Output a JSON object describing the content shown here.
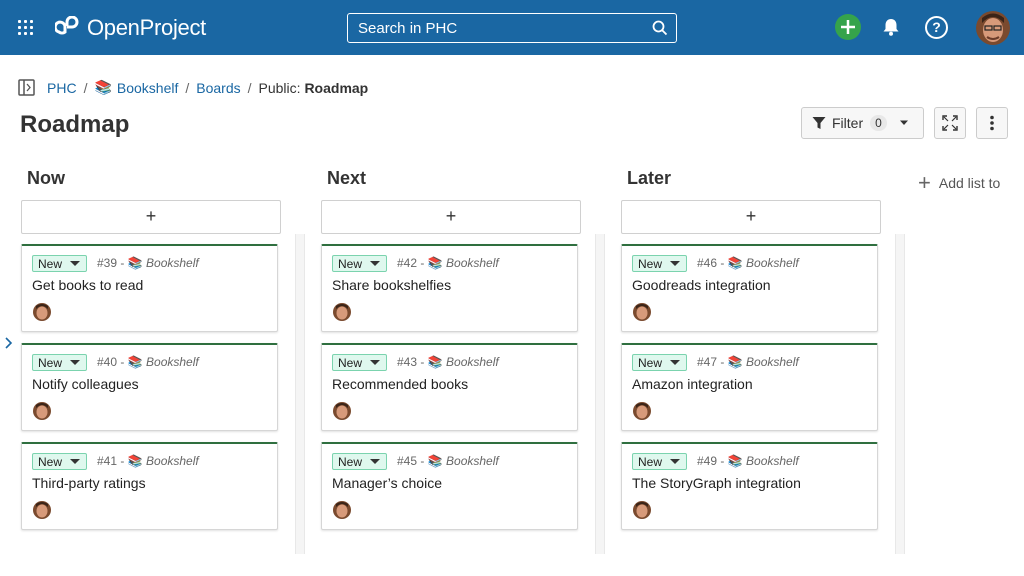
{
  "header": {
    "logo_text": "OpenProject",
    "search_placeholder": "Search in PHC",
    "accent": "#1a67a3",
    "add_color": "#35a34b"
  },
  "breadcrumb": {
    "items": [
      "PHC",
      "Bookshelf",
      "Boards"
    ],
    "current_prefix": "Public:",
    "current_name": "Roadmap"
  },
  "page": {
    "title": "Roadmap"
  },
  "toolbar": {
    "filter_label": "Filter",
    "filter_count": "0"
  },
  "add_card_label": "+",
  "add_list_label": "Add list to",
  "columns": [
    {
      "title": "Now",
      "cards": [
        {
          "status": "New",
          "id": "#39",
          "project": "Bookshelf",
          "title": "Get books to read"
        },
        {
          "status": "New",
          "id": "#40",
          "project": "Bookshelf",
          "title": "Notify colleagues"
        },
        {
          "status": "New",
          "id": "#41",
          "project": "Bookshelf",
          "title": "Third-party ratings"
        }
      ]
    },
    {
      "title": "Next",
      "cards": [
        {
          "status": "New",
          "id": "#42",
          "project": "Bookshelf",
          "title": "Share bookshelfies"
        },
        {
          "status": "New",
          "id": "#43",
          "project": "Bookshelf",
          "title": "Recommended books"
        },
        {
          "status": "New",
          "id": "#45",
          "project": "Bookshelf",
          "title": "Manager’s choice"
        }
      ]
    },
    {
      "title": "Later",
      "cards": [
        {
          "status": "New",
          "id": "#46",
          "project": "Bookshelf",
          "title": "Goodreads integration"
        },
        {
          "status": "New",
          "id": "#47",
          "project": "Bookshelf",
          "title": "Amazon integration"
        },
        {
          "status": "New",
          "id": "#49",
          "project": "Bookshelf",
          "title": "The StoryGraph integration"
        }
      ]
    }
  ],
  "icons": {
    "project": "books-icon",
    "separator": "-"
  }
}
